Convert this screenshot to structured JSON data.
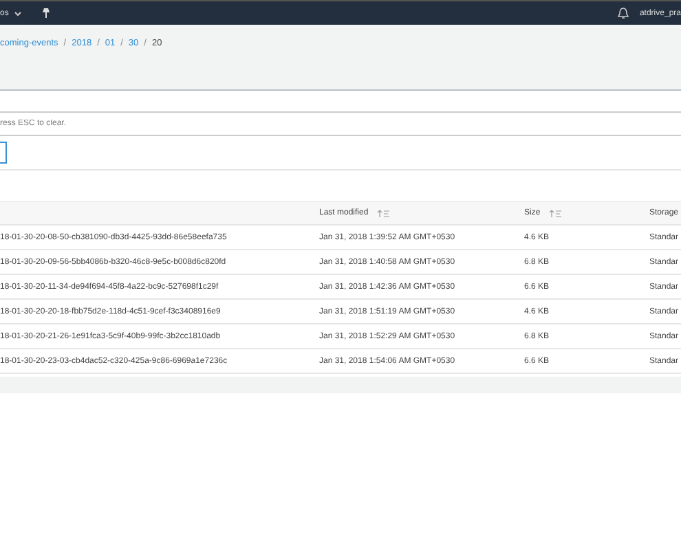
{
  "top_nav": {
    "menu_label": "os",
    "user": "atdrive_pra"
  },
  "breadcrumb": [
    {
      "kind": "link",
      "label": "coming-events"
    },
    {
      "kind": "separator",
      "label": "/"
    },
    {
      "kind": "link",
      "label": "2018"
    },
    {
      "kind": "separator",
      "label": "/"
    },
    {
      "kind": "link",
      "label": "01"
    },
    {
      "kind": "separator",
      "label": "/"
    },
    {
      "kind": "link",
      "label": "30"
    },
    {
      "kind": "separator",
      "label": "/"
    },
    {
      "kind": "current",
      "label": "20"
    }
  ],
  "search": {
    "placeholder": "ress ESC to clear."
  },
  "table": {
    "columns": [
      {
        "sortable": false
      },
      {
        "label": "Last modified",
        "sortable": true
      },
      {
        "label": "Size",
        "sortable": true
      },
      {
        "label": "Storage",
        "sortable": false
      }
    ],
    "rows": [
      [
        "18-01-30-20-08-50-cb381090-db3d-4425-93dd-86e58eefa735",
        "Jan 31, 2018 1:39:52 AM GMT+0530",
        "4.6 KB",
        "Standar"
      ],
      [
        "18-01-30-20-09-56-5bb4086b-b320-46c8-9e5c-b008d6c820fd",
        "Jan 31, 2018 1:40:58 AM GMT+0530",
        "6.8 KB",
        "Standar"
      ],
      [
        "18-01-30-20-11-34-de94f694-45f8-4a22-bc9c-527698f1c29f",
        "Jan 31, 2018 1:42:36 AM GMT+0530",
        "6.6 KB",
        "Standar"
      ],
      [
        "18-01-30-20-20-18-fbb75d2e-118d-4c51-9cef-f3c3408916e9",
        "Jan 31, 2018 1:51:19 AM GMT+0530",
        "4.6 KB",
        "Standar"
      ],
      [
        "18-01-30-20-21-26-1e91fca3-5c9f-40b9-99fc-3b2cc1810adb",
        "Jan 31, 2018 1:52:29 AM GMT+0530",
        "6.8 KB",
        "Standar"
      ],
      [
        "18-01-30-20-23-03-cb4dac52-c320-425a-9c86-6969a1e7236c",
        "Jan 31, 2018 1:54:06 AM GMT+0530",
        "6.6 KB",
        "Standar"
      ]
    ]
  }
}
